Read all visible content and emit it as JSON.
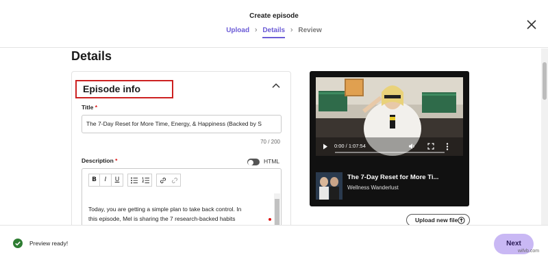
{
  "header": {
    "title": "Create episode",
    "steps": [
      {
        "label": "Upload",
        "state": "done"
      },
      {
        "label": "Details",
        "state": "active"
      },
      {
        "label": "Review",
        "state": "pending"
      }
    ],
    "close_icon": "close-icon"
  },
  "main": {
    "heading": "Details",
    "section": {
      "title": "Episode info",
      "collapse_icon": "chevron-up-icon"
    },
    "title_field": {
      "label": "Title",
      "required_mark": "*",
      "value": "The 7-Day Reset for More Time, Energy, & Happiness (Backed by S",
      "char_count": "70 / 200"
    },
    "description_field": {
      "label": "Description",
      "required_mark": "*",
      "html_toggle_label": "HTML",
      "html_toggle_on": false,
      "toolbar": {
        "bold": "B",
        "italic": "I",
        "underline": "U",
        "bullet_list_icon": "bullet-list-icon",
        "numbered_list_icon": "numbered-list-icon",
        "link_icon": "link-icon",
        "unlink_icon": "unlink-icon"
      },
      "text_lines": [
        "Today, you are getting a simple plan to take back control. In",
        "this episode, Mel is sharing the 7 research-backed habits"
      ]
    }
  },
  "video": {
    "current_time": "0:00",
    "duration": "1:07:54",
    "time_display": "0:00 / 1:07:54",
    "play_icon": "play-icon",
    "volume_icon": "volume-icon",
    "fullscreen_icon": "fullscreen-icon",
    "more_icon": "more-vertical-icon",
    "episode_title": "The 7-Day Reset for More Ti...",
    "show_name": "Wellness Wanderlust",
    "upload_button": "Upload new file",
    "upload_icon": "upload-icon"
  },
  "footer": {
    "status": "Preview ready!",
    "status_icon": "check-circle-icon",
    "next_button": "Next",
    "watermark": "wifvb.com"
  },
  "colors": {
    "accent": "#6b5bd6",
    "next_button_bg": "#c9b8f4",
    "success": "#2e7d32",
    "highlight_box": "#cc1f1f",
    "required": "#dd1111"
  }
}
